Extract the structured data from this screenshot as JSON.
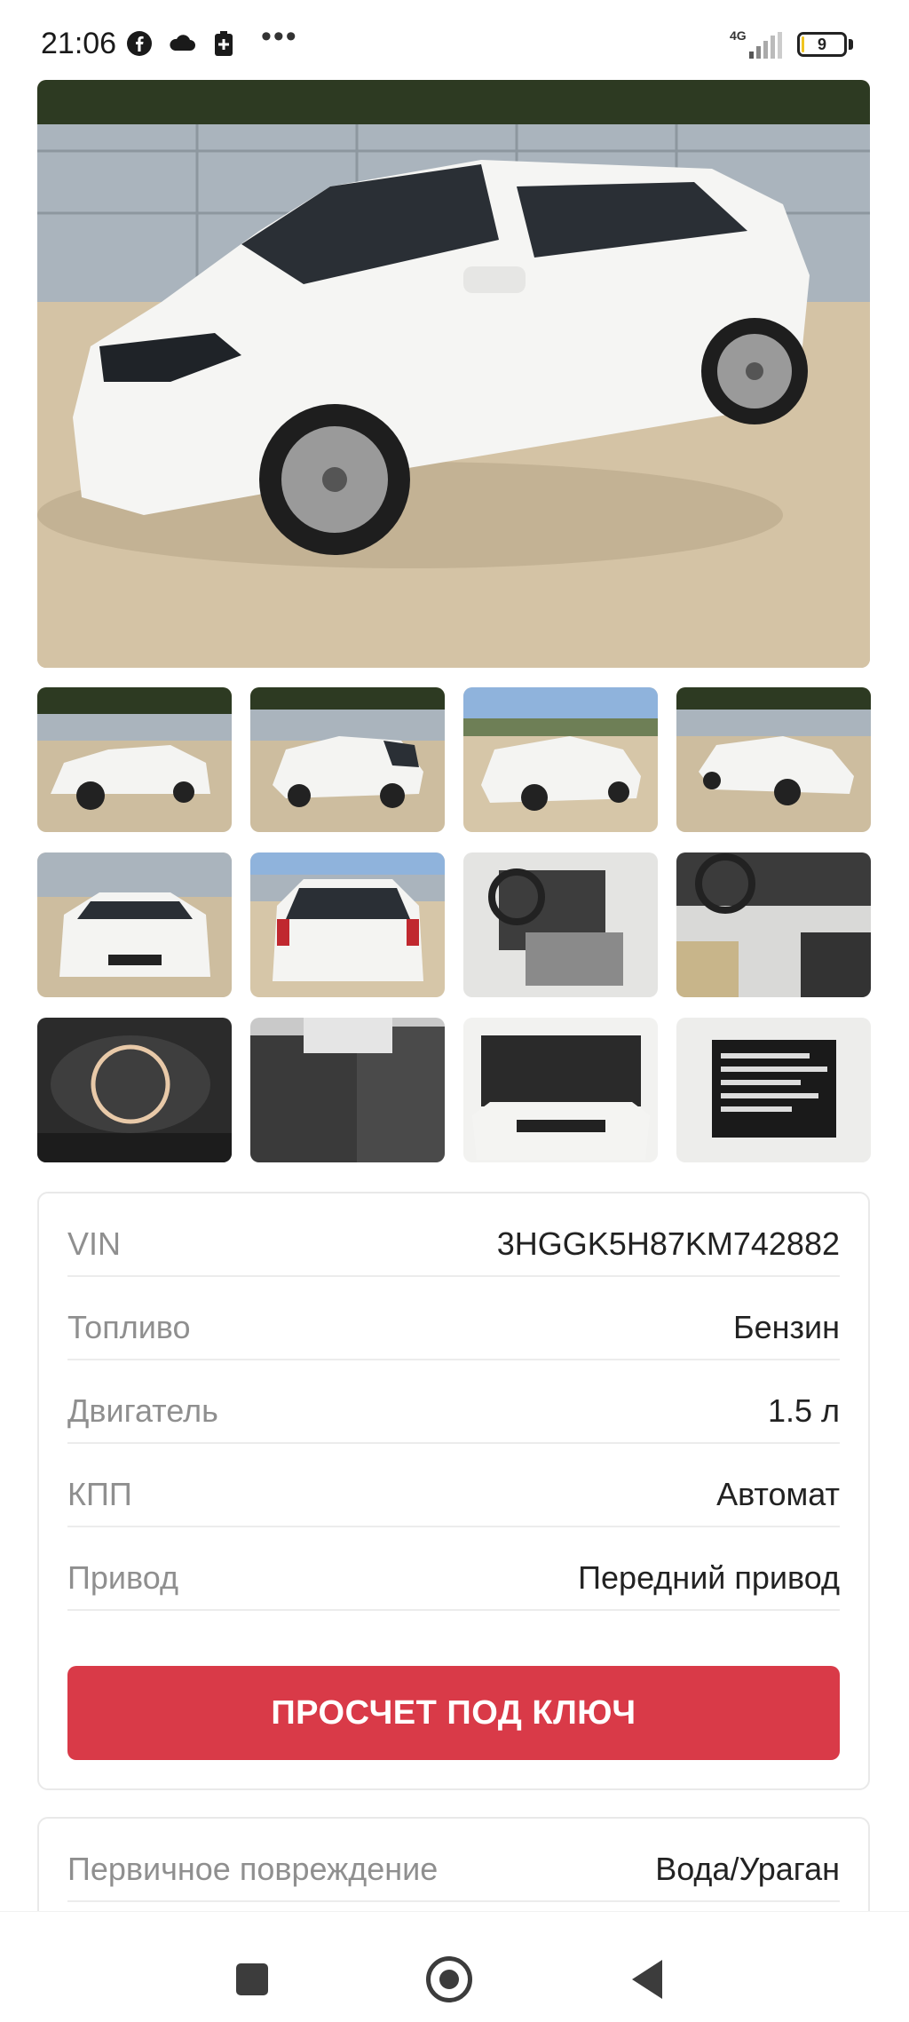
{
  "status_bar": {
    "time": "21:06",
    "network": "4G",
    "battery": "9",
    "battery_level_percent": 9,
    "icons": [
      "facebook-icon",
      "cloud-icon",
      "battery-saver-icon",
      "more-dots-icon",
      "signal-icon",
      "battery-icon"
    ],
    "dots": "•••"
  },
  "gallery": {
    "main_photo_icon": "car-photo",
    "thumbnail_count": 12
  },
  "specs": {
    "rows": [
      {
        "label": "VIN",
        "value": "3HGGK5H87KM742882"
      },
      {
        "label": "Топливо",
        "value": "Бензин"
      },
      {
        "label": "Двигатель",
        "value": "1.5 л"
      },
      {
        "label": "КПП",
        "value": "Автомат"
      },
      {
        "label": "Привод",
        "value": "Передний привод"
      }
    ],
    "button_label": "ПРОСЧЕТ ПОД КЛЮЧ"
  },
  "damage": {
    "rows": [
      {
        "label": "Первичное повреждение",
        "value": "Вода/Ураган"
      }
    ]
  },
  "colors": {
    "accent": "#d93a48",
    "label_gray": "#8f8f8f",
    "divider": "#ececec"
  },
  "nav_bar": {
    "icons": [
      "recent-apps-icon",
      "home-icon",
      "back-icon"
    ]
  }
}
